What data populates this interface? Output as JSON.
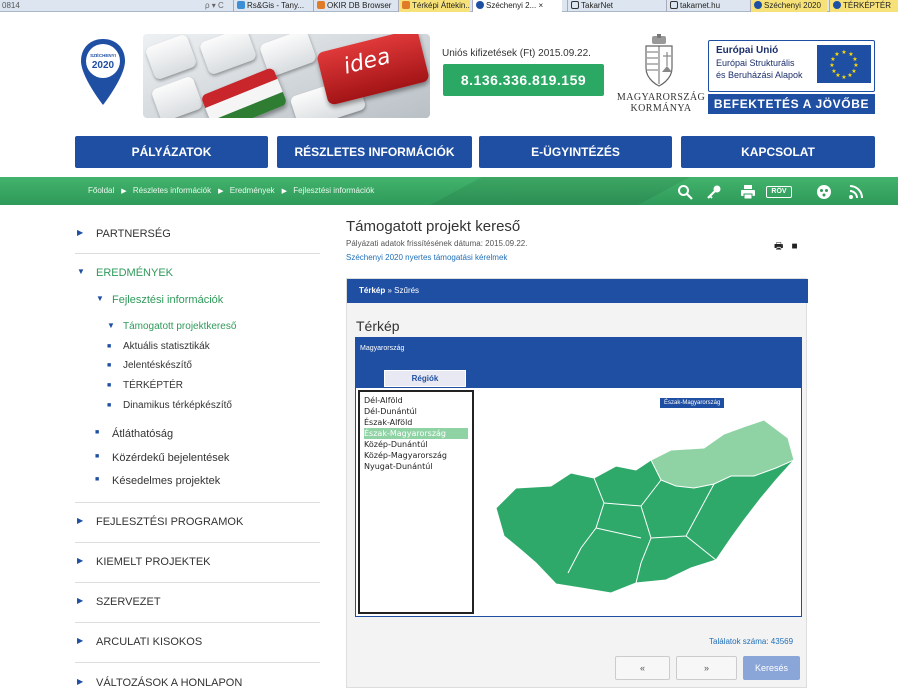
{
  "browser": {
    "address_fragment": "0814",
    "nav_controls": "ρ ▾ C",
    "tabs": [
      {
        "label": "Rs&Gis - Tany..."
      },
      {
        "label": "OKIR DB Browser"
      },
      {
        "label": "Térképi Áttekin..."
      },
      {
        "label": "Széchenyi 2..."
      },
      {
        "label": "TakarNet"
      },
      {
        "label": "takarnet.hu"
      },
      {
        "label": "Széchenyi 2020"
      },
      {
        "label": "TÉRKÉPTÉR"
      }
    ]
  },
  "header": {
    "logo_text_top": "SZÉCHENYI",
    "logo_text_year": "2020",
    "banner_key_text": "idea",
    "payout_label": "Uniós kifizetések (Ft) 2015.09.22.",
    "payout_value": "8.136.336.819.159",
    "gov_line1": "MAGYARORSZÁG",
    "gov_line2": "KORMÁNYA",
    "eu_title": "Európai Unió",
    "eu_line2": "Európai Strukturális",
    "eu_line3": "és Beruházási Alapok",
    "eu_slogan": "BEFEKTETÉS A JÖVŐBE"
  },
  "nav": {
    "items": [
      "PÁLYÁZATOK",
      "RÉSZLETES INFORMÁCIÓK",
      "E-ÜGYINTÉZÉS",
      "KAPCSOLAT"
    ]
  },
  "breadcrumb": {
    "items": [
      "Főoldal",
      "Részletes információk",
      "Eredmények",
      "Fejlesztési információk"
    ],
    "rov_label": "RÖV"
  },
  "sidebar": {
    "partnerseg": "PARTNERSÉG",
    "eredmenyek": "EREDMÉNYEK",
    "fejlesztesi": "Fejlesztési információk",
    "sub": [
      "Támogatott projektkereső",
      "Aktuális statisztikák",
      "Jelentéskészítő",
      "TÉRKÉPTÉR",
      "Dinamikus térképkészítő"
    ],
    "sub2": [
      "Átláthatóság",
      "Közérdekű bejelentések",
      "Késedelmes projektek"
    ],
    "main": [
      "FEJLESZTÉSI PROGRAMOK",
      "KIEMELT PROJEKTEK",
      "SZERVEZET",
      "ARCULATI KISOKOS",
      "VÁLTOZÁSOK A HONLAPON"
    ]
  },
  "content": {
    "title": "Támogatott projekt kereső",
    "updated": "Pályázati adatok frissítésének dátuma: 2015.09.22.",
    "link": "Széchenyi 2020 nyertes támogatási kérelmek",
    "panel_head_bold": "Térkép",
    "panel_head_sep": "»",
    "panel_head_rest": "Szűrés",
    "panel_title": "Térkép",
    "map_label": "Magyarország",
    "regions_tab": "Régiók",
    "regions": [
      "Dél-Alföld",
      "Dél-Dunántúl",
      "Észak-Alföld",
      "Észak-Magyarország",
      "Közép-Dunántúl",
      "Közép-Magyarország",
      "Nyugat-Dunántúl"
    ],
    "selected_region": "Észak-Magyarország",
    "map_tooltip": "Észak-Magyarország",
    "hits_label": "Találatok száma: 43569",
    "prev_label": "«",
    "next_label": "»",
    "search_label": "Keresés"
  },
  "colors": {
    "brand_blue": "#1f4fa3",
    "brand_green": "#2f9a5a",
    "map_green": "#2ea96a",
    "map_highlight": "#8fd3a5"
  }
}
